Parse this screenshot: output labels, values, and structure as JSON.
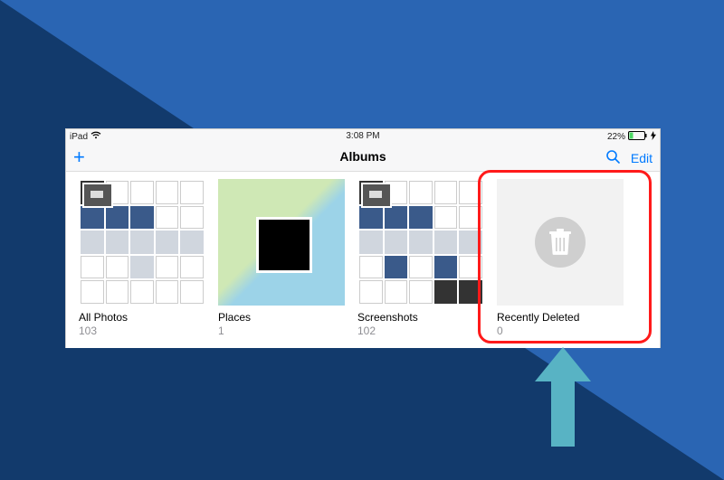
{
  "statusbar": {
    "device": "iPad",
    "time": "3:08 PM",
    "battery_pct": "22%"
  },
  "navbar": {
    "add_label": "+",
    "title": "Albums",
    "edit_label": "Edit"
  },
  "albums": [
    {
      "name": "All Photos",
      "count": "103"
    },
    {
      "name": "Places",
      "count": "1"
    },
    {
      "name": "Screenshots",
      "count": "102"
    },
    {
      "name": "Recently Deleted",
      "count": "0"
    }
  ],
  "colors": {
    "ios_blue": "#007aff",
    "highlight_red": "#ff1a1a",
    "arrow_teal": "#58b3c4"
  }
}
